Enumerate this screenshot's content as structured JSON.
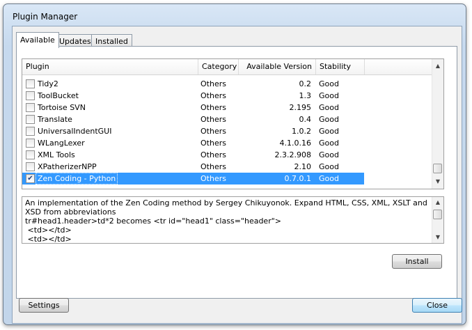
{
  "window": {
    "title": "Plugin Manager"
  },
  "tabs": [
    {
      "label": "Available",
      "active": true
    },
    {
      "label": "Updates",
      "active": false
    },
    {
      "label": "Installed",
      "active": false
    }
  ],
  "list": {
    "columns": [
      "Plugin",
      "Category",
      "Available Version",
      "Stability"
    ],
    "rows": [
      {
        "name": "Tidy2",
        "category": "Others",
        "version": "0.2",
        "stability": "Good",
        "checked": false,
        "selected": false
      },
      {
        "name": "ToolBucket",
        "category": "Others",
        "version": "1.3",
        "stability": "Good",
        "checked": false,
        "selected": false
      },
      {
        "name": "Tortoise SVN",
        "category": "Others",
        "version": "2.195",
        "stability": "Good",
        "checked": false,
        "selected": false
      },
      {
        "name": "Translate",
        "category": "Others",
        "version": "0.4",
        "stability": "Good",
        "checked": false,
        "selected": false
      },
      {
        "name": "UniversalIndentGUI",
        "category": "Others",
        "version": "1.0.2",
        "stability": "Good",
        "checked": false,
        "selected": false
      },
      {
        "name": "WLangLexer",
        "category": "Others",
        "version": "4.1.0.16",
        "stability": "Good",
        "checked": false,
        "selected": false
      },
      {
        "name": "XML Tools",
        "category": "Others",
        "version": "2.3.2.908",
        "stability": "Good",
        "checked": false,
        "selected": false
      },
      {
        "name": "XPatherizerNPP",
        "category": "Others",
        "version": "2.10",
        "stability": "Good",
        "checked": false,
        "selected": false
      },
      {
        "name": "Zen Coding - Python",
        "category": "Others",
        "version": "0.7.0.1",
        "stability": "Good",
        "checked": true,
        "selected": true
      }
    ],
    "scroll_position": 0.97
  },
  "description": {
    "lines": [
      "An implementation of the Zen Coding method by Sergey Chikuyonok. Expand HTML, CSS, XML, XSLT and XSD from abbreviations",
      "tr#head1.header>td*2 becomes <tr id=\"head1\" class=\"header\">",
      " <td></td>",
      " <td></td>"
    ],
    "scroll_position": 0.1
  },
  "buttons": {
    "install": "Install",
    "settings": "Settings",
    "close": "Close"
  },
  "icons": {
    "checkbox_checked": "checkmark-icon",
    "scroll_up": "scroll-up-arrow-icon",
    "scroll_down": "scroll-down-arrow-icon"
  },
  "colors": {
    "selection": "#3399ff",
    "window_frame": "#c6d9ee"
  }
}
